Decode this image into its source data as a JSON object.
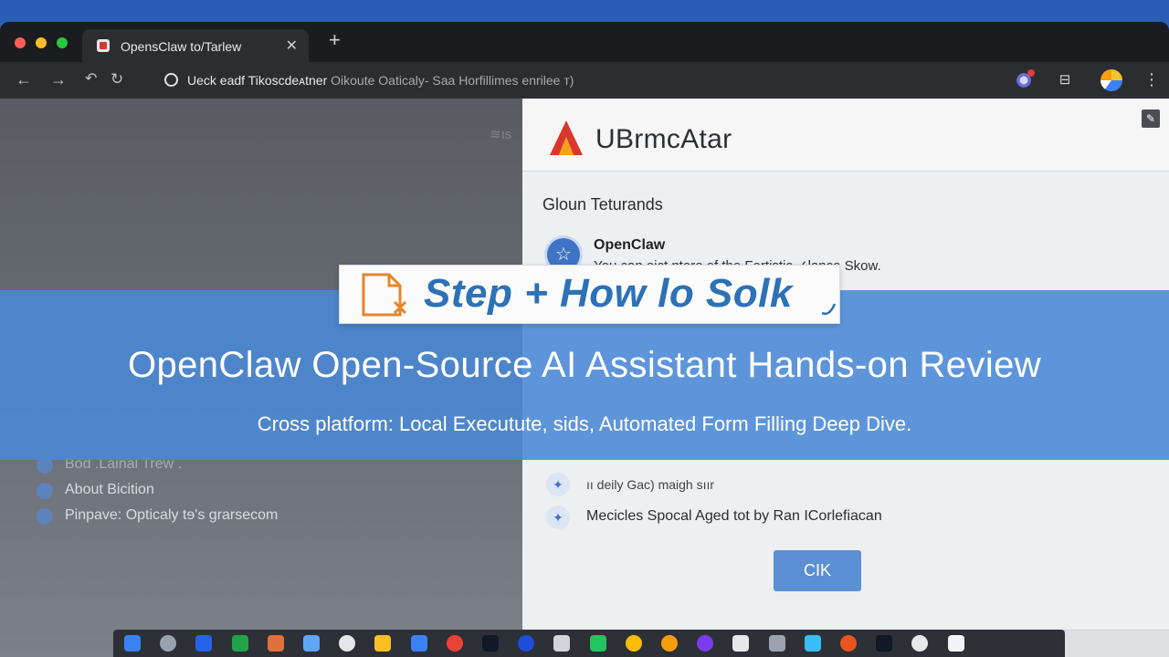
{
  "browser": {
    "tab_title": "OpensClaw to/Tarlew",
    "tab_close": "✕",
    "new_tab": "+",
    "url_main": "Ueck eadf  Tikoscdeᴀtner",
    "url_rest": " Oikoute Oaticaly-  Saa Horfillimes enrilee т)",
    "nav_back": "←",
    "nav_forward": "→",
    "nav_history": "↶",
    "nav_reload": "↻",
    "extension_mid": "⊟",
    "menu": "⋮"
  },
  "left_pane": {
    "corner_mark": "≋ıs",
    "items": [
      {
        "label": "Bod .Lainal Trew ."
      },
      {
        "label": "About Bicition"
      },
      {
        "label": "Pinpave: Opticaly tɘ's grarsecom"
      }
    ]
  },
  "right_pane": {
    "brand_name": "UBrmcAtar",
    "edit_icon": "✎",
    "section_heading": "Gloun Teturands",
    "assistant": {
      "avatar": "☆",
      "name": "OpenClaw",
      "message": "You can eict ntere of the Fertistic ✓lance Skow."
    },
    "rows": [
      {
        "icon": "✦",
        "label": "ıı deily Gac) maigh sıır"
      },
      {
        "icon": "✦",
        "label": "Mecicles Spocal Aged tot by Ran ICorlefiacan"
      }
    ],
    "ok_button": "CIK"
  },
  "banner": {
    "step_label": "Step + How lo Solk",
    "title": "OpenClaw Open-Source AI Assistant Hands-on Review",
    "subtitle": "Cross platform: Local Executute, sids, Automated Form Filling Deep Dive."
  },
  "taskbar": {
    "icons": [
      {
        "name": "windows-icon",
        "color": "#3b82f6"
      },
      {
        "name": "calculator-icon",
        "color": "#9aa3ad"
      },
      {
        "name": "home-icon",
        "color": "#2563eb"
      },
      {
        "name": "spreadsheet-icon",
        "color": "#22a34a"
      },
      {
        "name": "photos-icon",
        "color": "#e2703a"
      },
      {
        "name": "document-icon",
        "color": "#60a5fa"
      },
      {
        "name": "edge-icon",
        "color": "#e5e7eb"
      },
      {
        "name": "notes-icon",
        "color": "#fbbf24"
      },
      {
        "name": "puzzle-icon",
        "color": "#3b82f6"
      },
      {
        "name": "chrome-icon",
        "color": "#ea4335"
      },
      {
        "name": "phone-icon",
        "color": "#111827"
      },
      {
        "name": "editor-icon",
        "color": "#1d4ed8"
      },
      {
        "name": "check-icon",
        "color": "#d1d5db"
      },
      {
        "name": "arrows-icon",
        "color": "#22c55e"
      },
      {
        "name": "chrome2-icon",
        "color": "#fbbc05"
      },
      {
        "name": "people-icon",
        "color": "#f59e0b"
      },
      {
        "name": "tor-icon",
        "color": "#7c3aed"
      },
      {
        "name": "file-icon",
        "color": "#e5e7eb"
      },
      {
        "name": "tools-icon",
        "color": "#9ca3af"
      },
      {
        "name": "folder-icon",
        "color": "#38bdf8"
      },
      {
        "name": "ubuntu-icon",
        "color": "#e95420"
      },
      {
        "name": "terminal-icon",
        "color": "#111827"
      },
      {
        "name": "settings-icon",
        "color": "#e5e7eb"
      },
      {
        "name": "chat-icon",
        "color": "#f3f4f6"
      }
    ]
  },
  "colors": {
    "banner": "#4a89d6",
    "accent": "#2d71b6",
    "ok_button": "#5b8fd3",
    "step_icon": "#e8842a"
  }
}
